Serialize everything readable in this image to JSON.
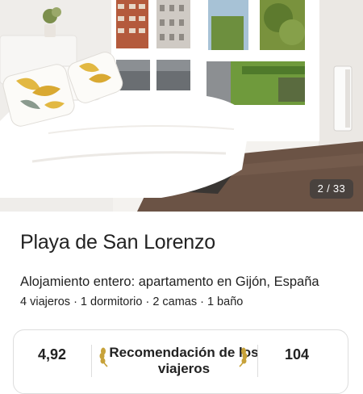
{
  "listing": {
    "photo_counter": "2 / 33",
    "title": "Playa de San Lorenzo",
    "subtitle": "Alojamiento entero: apartamento en Gijón, España",
    "stats": [
      "4 viajeros",
      "1 dormitorio",
      "2 camas",
      "1 baño"
    ],
    "stats_separator": "·"
  },
  "highlights": {
    "rating": "4,92",
    "guest_favorite_label": "Recomendación de los viajeros",
    "reviews_count": "104"
  },
  "colors": {
    "text": "#222222",
    "divider": "#dddddd",
    "counter_bg": "#3c3c3c",
    "laurel": "#222222"
  }
}
